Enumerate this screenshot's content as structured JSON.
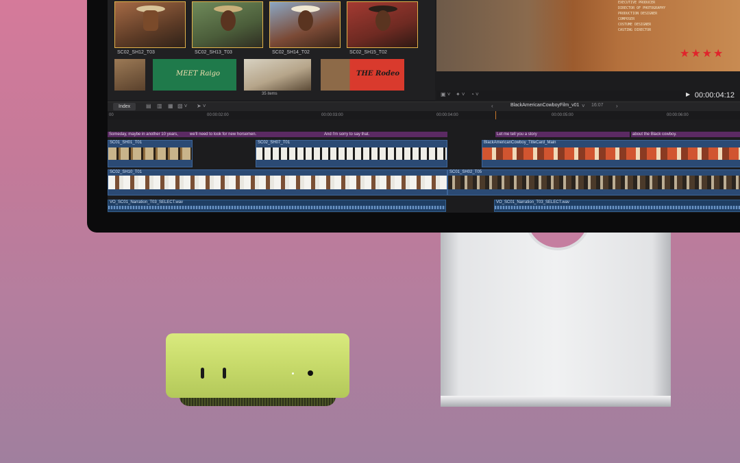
{
  "browser": {
    "clips_row1": [
      "SC02_SH12_T03",
      "SC02_SH13_T03",
      "SC02_SH14_T02",
      "SC02_SH15_T02"
    ],
    "thumb_text_1": "MEET Raigo",
    "thumb_text_2": "THE Rodeo",
    "items_count": "35 items"
  },
  "viewer": {
    "credits": [
      "EXECUTIVE PRODUCER",
      "DIRECTOR OF PHOTOGRAPHY",
      "PRODUCTION DESIGNER",
      "COMPOSER",
      "COSTUME DESIGNER",
      "CASTING DIRECTOR"
    ],
    "stars": "★★★★",
    "timecode": "00:00:04:12"
  },
  "timeline": {
    "index_label": "Index",
    "project_name": "BlackAmericanCowboyFilm_v01",
    "project_duration": "16:07",
    "ruler_ticks": [
      "00",
      "00:00:02:00",
      "00:00:03:00",
      "00:00:04:00",
      "00:00:05:00",
      "00:00:06:00"
    ],
    "captions": [
      "Someday, maybe in another 10 years,",
      "we'll need to look for new horsemen.",
      "And I'm sorry to say that.",
      "Let me tell you a story",
      "about the Black cowboy."
    ],
    "clips": {
      "c1": "SC01_SH01_T01",
      "c2": "SC02_SH07_T01",
      "c3": "BlackAmericanCowboy_TitleCard_Main",
      "c4": "SC02_SH10_T01",
      "c5": "SC01_SH02_T05"
    },
    "audio": [
      "VO_SC01_Narration_T03_SELECT.wav",
      "VO_SC01_Narration_T03_SELECT.wav"
    ]
  },
  "colors": {
    "background_top": "#d57a9a",
    "background_bottom": "#a07f9e",
    "mac_mini": "#c7da6a",
    "caption": "#5b2a63",
    "clip": "#2b4a74",
    "selection": "#e3b34a"
  }
}
